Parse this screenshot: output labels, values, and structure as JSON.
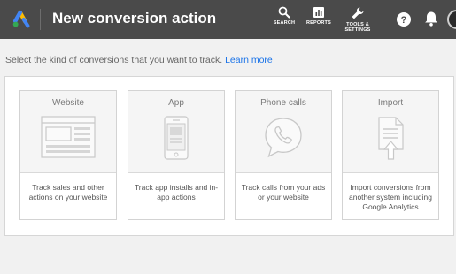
{
  "header": {
    "title": "New conversion action",
    "tools": [
      {
        "label": "SEARCH",
        "icon": "search-icon"
      },
      {
        "label": "REPORTS",
        "icon": "reports-icon"
      },
      {
        "label": "TOOLS &",
        "label2": "SETTINGS",
        "icon": "wrench-icon"
      }
    ],
    "help_icon": "help-icon",
    "notifications_icon": "bell-icon",
    "colors": {
      "bar": "#4a4a4a",
      "text": "#ffffff"
    }
  },
  "instruction": {
    "text": "Select the kind of conversions that you want to track.",
    "link": "Learn more",
    "link_color": "#1a73e8"
  },
  "cards": [
    {
      "title": "Website",
      "description": "Track sales and other actions on your website",
      "icon": "website-icon"
    },
    {
      "title": "App",
      "description": "Track app installs and in-app actions",
      "icon": "phone-app-icon"
    },
    {
      "title": "Phone calls",
      "description": "Track calls from your ads or your website",
      "icon": "phone-call-icon"
    },
    {
      "title": "Import",
      "description": "Import conversions from another system including Google Analytics",
      "icon": "import-file-icon"
    }
  ]
}
